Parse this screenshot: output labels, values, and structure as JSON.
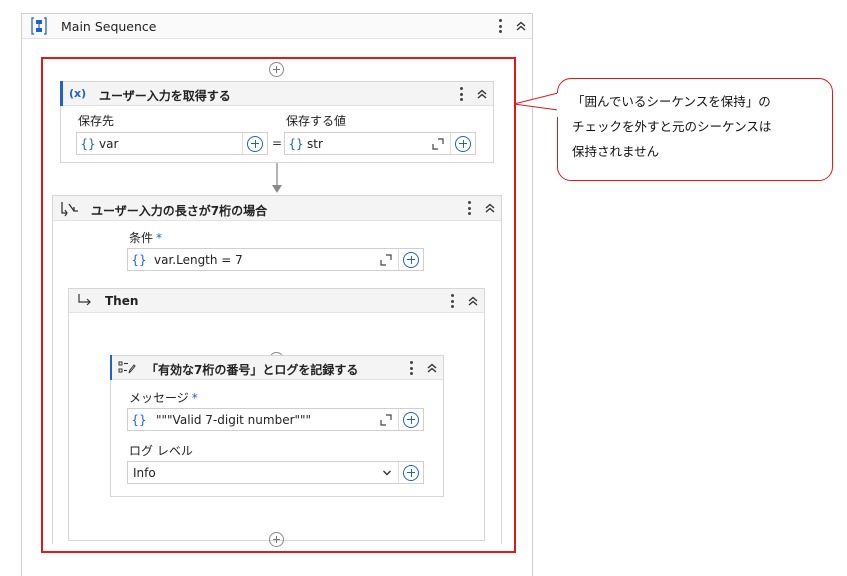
{
  "main_sequence": {
    "title": "Main Sequence",
    "icon": "sequence-icon"
  },
  "get_input": {
    "title": "ユーザー入力を取得する",
    "icon_glyph": "(x)",
    "save_to_label": "保存先",
    "save_to_value": "var",
    "value_label": "保存する値",
    "value_value": "str",
    "brace": "{}",
    "equals": "="
  },
  "if_block": {
    "title": "ユーザー入力の長さが7桁の場合",
    "condition_label": "条件",
    "required_mark": "*",
    "condition_value": "var.Length = 7"
  },
  "then_block": {
    "title": "Then"
  },
  "log_block": {
    "title": "「有効な7桁の番号」とログを記録する",
    "message_label": "メッセージ",
    "message_value": "\"\"\"Valid 7-digit number\"\"\"",
    "log_level_label": "ログ レベル",
    "log_level_value": "Info"
  },
  "callout": {
    "lines": [
      "「囲んでいるシーケンスを保持」の",
      "チェックを外すと元のシーケンスは",
      "保持されません"
    ]
  },
  "colors": {
    "accent_blue": "#1e64c8",
    "highlight_red": "#e01919",
    "border_gray": "#cfcfcf"
  }
}
